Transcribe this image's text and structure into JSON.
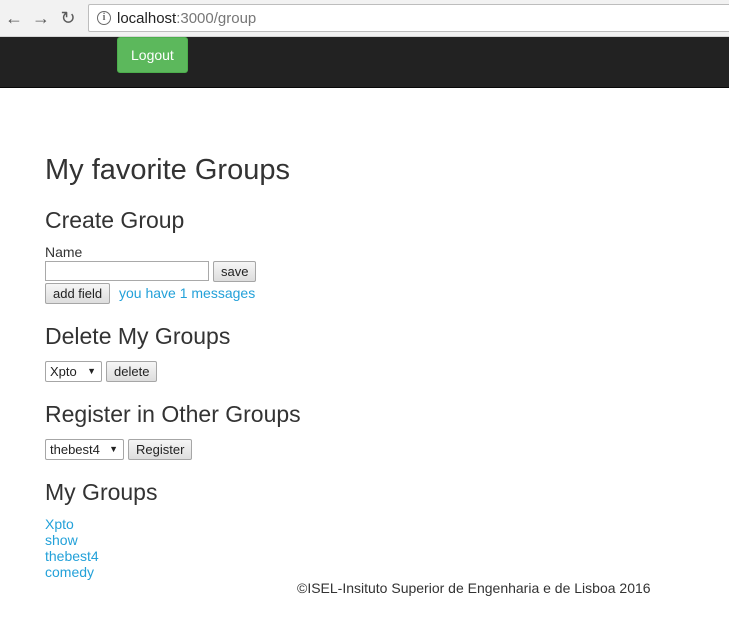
{
  "browser": {
    "url_host": "localhost",
    "url_path": ":3000/group",
    "back_icon": "arrow-left-icon",
    "forward_icon": "arrow-right-icon",
    "reload_icon": "reload-icon",
    "info_icon": "info-icon"
  },
  "navbar": {
    "logout_label": "Logout",
    "logout_color": "#5cb85c",
    "background": "#222222"
  },
  "page": {
    "title": "My favorite Groups",
    "create": {
      "heading": "Create Group",
      "name_label": "Name",
      "name_value": "",
      "save_label": "save",
      "add_field_label": "add field",
      "messages_link": "you have 1 messages"
    },
    "delete": {
      "heading": "Delete My Groups",
      "selected": "Xpto",
      "delete_label": "delete"
    },
    "register": {
      "heading": "Register in Other Groups",
      "selected": "thebest4",
      "register_label": "Register"
    },
    "my_groups": {
      "heading": "My Groups",
      "items": [
        "Xpto",
        "show",
        "thebest4",
        "comedy"
      ]
    },
    "footer": "©ISEL-Insituto Superior de Engenharia e de Lisboa 2016",
    "link_color": "#23a1d9"
  }
}
